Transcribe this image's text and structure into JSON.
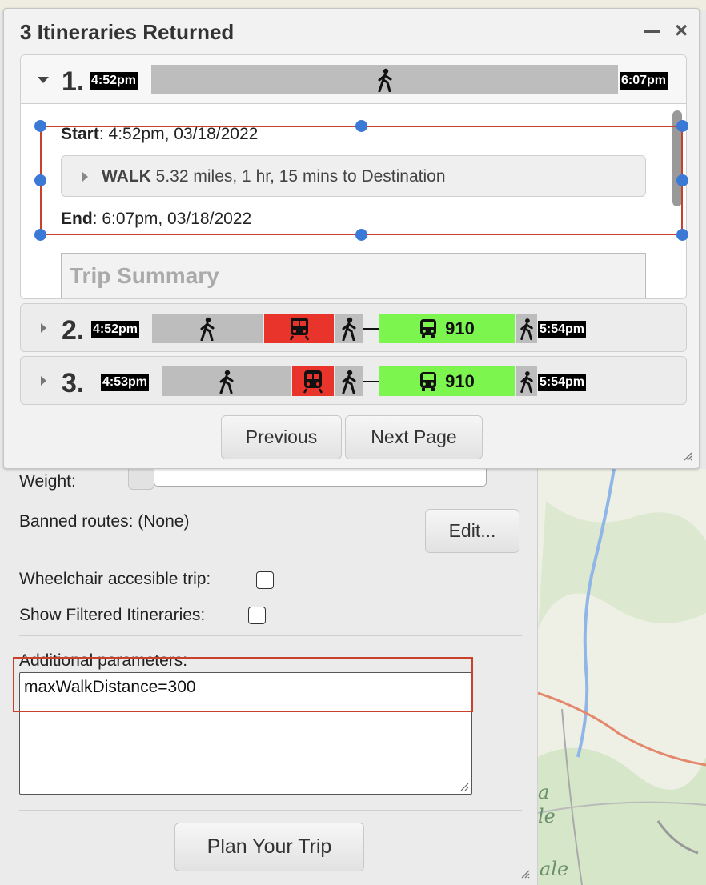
{
  "dialog": {
    "title": "3 Itineraries Returned",
    "minimize_icon": "minus-icon",
    "close_icon": "close-icon",
    "close_glyph": "×"
  },
  "itineraries": [
    {
      "number": "1.",
      "start_time": "4:52pm",
      "end_time": "6:07pm",
      "expanded": true,
      "legs": [
        "walk"
      ],
      "details": {
        "start_label": "Start",
        "start_value": ": 4:52pm, 03/18/2022",
        "leg_mode": "WALK",
        "leg_desc": "5.32 miles, 1 hr, 15 mins to Destination",
        "end_label": "End",
        "end_value": ": 6:07pm, 03/18/2022",
        "summary_title": "Trip Summary"
      }
    },
    {
      "number": "2.",
      "start_time": "4:52pm",
      "end_time": "5:54pm",
      "expanded": false,
      "legs": [
        "walk",
        "rail",
        "walk",
        "bus",
        "walk"
      ],
      "bus_route": "910"
    },
    {
      "number": "3.",
      "start_time": "4:53pm",
      "end_time": "5:54pm",
      "expanded": false,
      "legs": [
        "walk",
        "rail",
        "walk",
        "bus",
        "walk"
      ],
      "bus_route": "910"
    }
  ],
  "pager": {
    "previous_label": "Previous",
    "next_label": "Next Page"
  },
  "form": {
    "weight_label": "Weight:",
    "banned_routes_label": "Banned routes: (None)",
    "edit_label": "Edit...",
    "wheelchair_label": "Wheelchair accesible trip:",
    "wheelchair_checked": false,
    "show_filtered_label": "Show Filtered Itineraries:",
    "show_filtered_checked": false,
    "additional_label": "Additional parameters:",
    "additional_value": "maxWalkDistance=300",
    "plan_label": "Plan Your Trip"
  },
  "map": {
    "label_1": "a",
    "label_2": "le",
    "label_3": "ale"
  },
  "colors": {
    "walk": "#bdbdbd",
    "rail": "#e8342a",
    "bus": "#7cf54f",
    "highlight": "#c8412a",
    "handle": "#3a79d6"
  }
}
